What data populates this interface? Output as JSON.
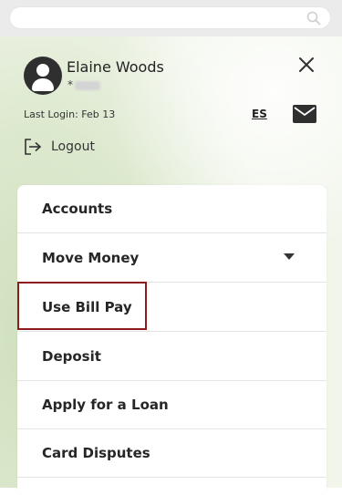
{
  "search": {
    "placeholder": ""
  },
  "user": {
    "name": "Elaine Woods",
    "masked_account": "*"
  },
  "last_login": "Last Login: Feb 13",
  "language_toggle": "ES",
  "logout_label": "Logout",
  "menu": {
    "items": [
      {
        "label": "Accounts"
      },
      {
        "label": "Move Money",
        "has_dropdown": true
      },
      {
        "label": "Use Bill Pay",
        "highlighted": true
      },
      {
        "label": "Deposit"
      },
      {
        "label": "Apply for a Loan"
      },
      {
        "label": "Card Disputes"
      }
    ]
  },
  "icons": [
    "search-icon",
    "avatar-icon",
    "close-icon",
    "mail-icon",
    "logout-icon",
    "chevron-down-icon"
  ],
  "colors": {
    "highlight_border": "#8e1c1c",
    "panel_tint": "#dde9cf"
  }
}
